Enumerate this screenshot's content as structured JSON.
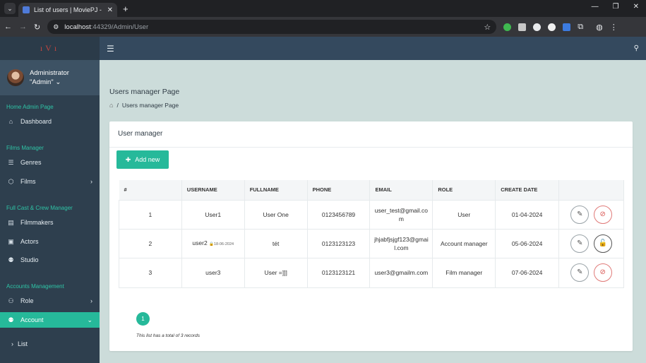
{
  "browser": {
    "tab_title": "List of users | MoviePJ - Admin",
    "url_host": "localhost",
    "url_path": ":44329/Admin/User"
  },
  "sidebar": {
    "user": {
      "name": "Administrator",
      "role": "\"Admin\""
    },
    "sections": [
      {
        "title": "Home Admin Page",
        "items": [
          {
            "label": "Dashboard",
            "icon": "home-icon"
          }
        ]
      },
      {
        "title": "Films Manager",
        "items": [
          {
            "label": "Genres",
            "icon": "list-icon"
          },
          {
            "label": "Films",
            "icon": "cube-icon",
            "expandable": true
          }
        ]
      },
      {
        "title": "Full Cast & Crew Manager",
        "items": [
          {
            "label": "Filmmakers",
            "icon": "film-icon"
          },
          {
            "label": "Actors",
            "icon": "id-card-icon"
          },
          {
            "label": "Studio",
            "icon": "users-icon"
          }
        ]
      },
      {
        "title": "Accounts Management",
        "items": [
          {
            "label": "Role",
            "icon": "user-gear-icon",
            "expandable": true
          },
          {
            "label": "Account",
            "icon": "user-group-icon",
            "expandable": true,
            "active": true
          }
        ]
      }
    ],
    "subitem": "List"
  },
  "main": {
    "page_title": "Users manager Page",
    "breadcrumb": "Users manager Page",
    "card_title": "User manager",
    "add_button": "Add new",
    "columns": [
      "#",
      "USERNAME",
      "FULLNAME",
      "PHONE",
      "EMAIL",
      "ROLE",
      "CREATE DATE",
      ""
    ],
    "rows": [
      {
        "num": "1",
        "username": "User1",
        "lock_date": "",
        "fullname": "User One",
        "phone": "0123456789",
        "email": "user_test@gmail.com",
        "role": "User",
        "created": "01-04-2024",
        "locked": false
      },
      {
        "num": "2",
        "username": "user2",
        "lock_date": "18-06-2024",
        "fullname": "tét",
        "phone": "0123123123",
        "email": "jhjabfjsjgf123@gmail.com",
        "role": "Account manager",
        "created": "05-06-2024",
        "locked": true
      },
      {
        "num": "3",
        "username": "user3",
        "lock_date": "",
        "fullname": "User =]]]",
        "phone": "0123123121",
        "email": "user3@gmailm.com",
        "role": "Film manager",
        "created": "07-06-2024",
        "locked": false
      }
    ],
    "page_number": "1",
    "records_note": "This list has a total of 3 records"
  },
  "colors": {
    "accent": "#26b99a",
    "sidebar": "#2e3f4e",
    "topbar": "#34495e",
    "ban": "#d9534f"
  }
}
